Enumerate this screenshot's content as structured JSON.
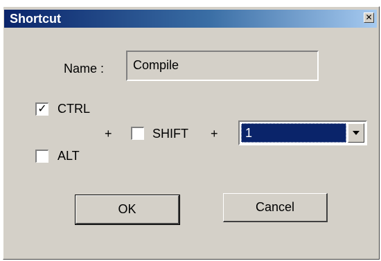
{
  "window": {
    "title": "Shortcut",
    "close_glyph": "✕"
  },
  "form": {
    "name_label": "Name :",
    "name_value": "Compile",
    "ctrl_label": "CTRL",
    "ctrl_checked": true,
    "alt_label": "ALT",
    "alt_checked": false,
    "shift_label": "SHIFT",
    "shift_checked": false,
    "plus1": "+",
    "plus2": "+",
    "key_value": "1",
    "check_glyph": "✓"
  },
  "buttons": {
    "ok_label": "OK",
    "cancel_label": "Cancel"
  },
  "colors": {
    "titlebar_start": "#0a246a",
    "titlebar_end": "#a6caf0",
    "dialog_bg": "#d4d0c8",
    "selection": "#0a246a"
  }
}
